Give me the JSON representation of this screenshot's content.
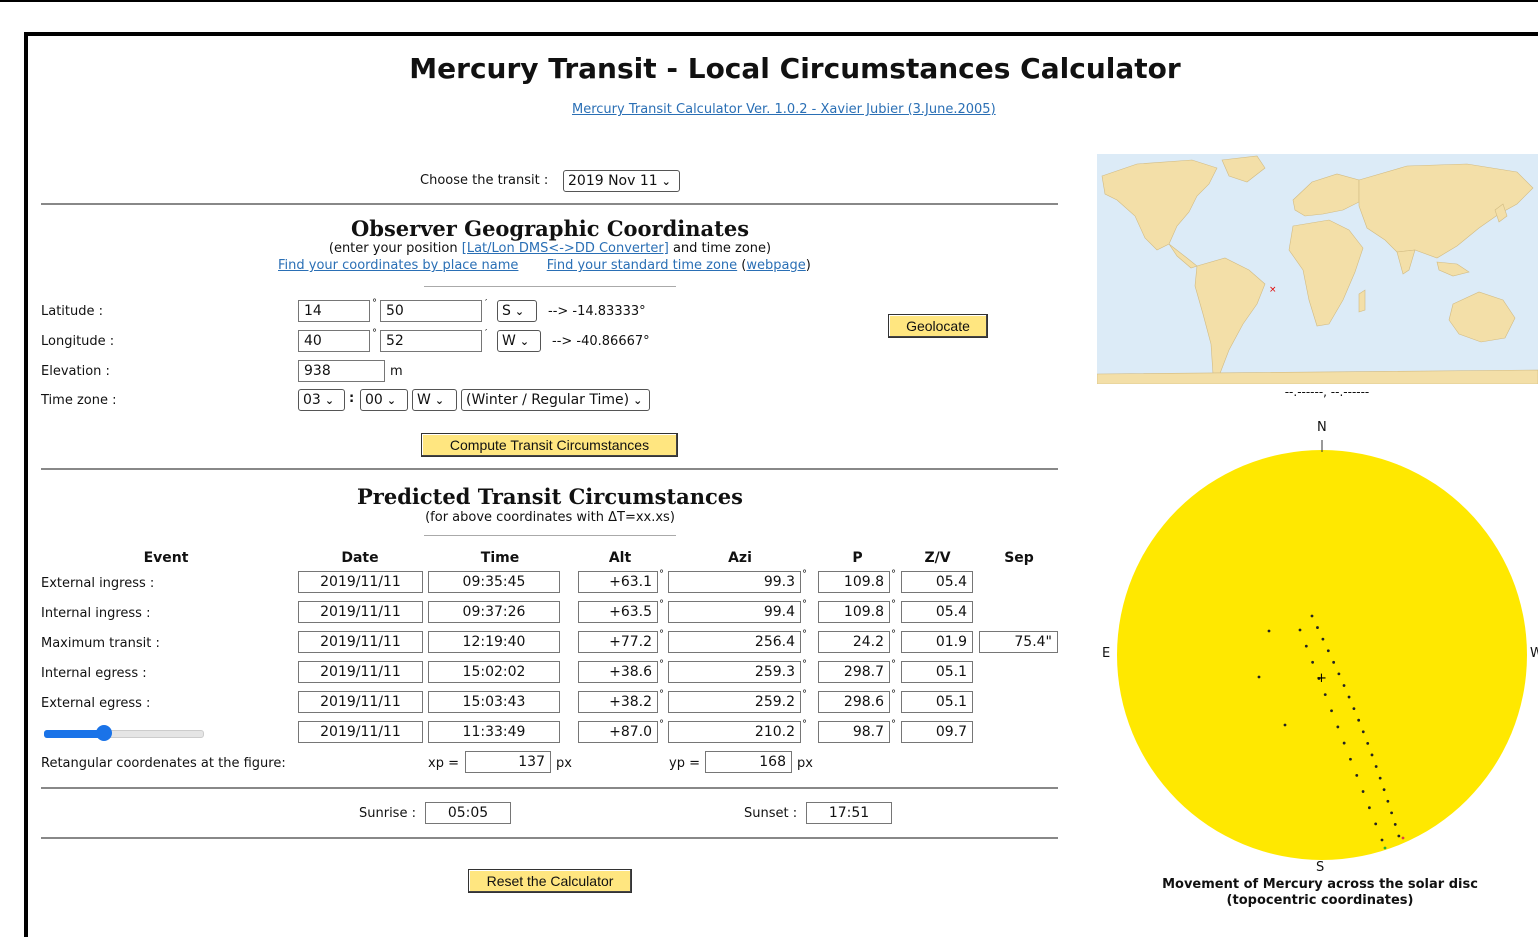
{
  "title": "Mercury Transit - Local Circumstances Calculator",
  "version_link": "Mercury Transit Calculator Ver. 1.0.2 - Xavier Jubier (3.June.2005)",
  "transit": {
    "label": "Choose the transit :",
    "selected": "2019 Nov 11"
  },
  "observer": {
    "heading": "Observer Geographic Coordinates",
    "note_prefix": "(enter your position",
    "converter_link": "[Lat/Lon DMS<->DD Converter]",
    "note_suffix": "and time zone)",
    "place_link": "Find your coordinates by place name",
    "tz_link": "Find your standard time zone",
    "webpage_link": "webpage",
    "latitude": {
      "label": "Latitude :",
      "deg": "14",
      "min": "50",
      "hemi": "S",
      "decimal": "--> -14.83333°"
    },
    "longitude": {
      "label": "Longitude :",
      "deg": "40",
      "min": "52",
      "hemi": "W",
      "decimal": "--> -40.86667°"
    },
    "elevation": {
      "label": "Elevation :",
      "value": "938",
      "unit": "m"
    },
    "timezone": {
      "label": "Time zone :",
      "hours": "03",
      "minutes": "00",
      "dir": "W",
      "kind": "(Winter / Regular Time)"
    },
    "geolocate": "Geolocate",
    "compute": "Compute Transit Circumstances"
  },
  "predicted": {
    "heading": "Predicted Transit Circumstances",
    "note": "(for above coordinates with ΔT=xx.xs)",
    "columns": [
      "Event",
      "Date",
      "Time",
      "Alt",
      "Azi",
      "P",
      "Z/V",
      "Sep"
    ],
    "rows": [
      {
        "event": "External ingress :",
        "date": "2019/11/11",
        "time": "09:35:45",
        "alt": "+63.1",
        "azi": "99.3",
        "p": "109.8",
        "zv": "05.4",
        "sep": ""
      },
      {
        "event": "Internal ingress :",
        "date": "2019/11/11",
        "time": "09:37:26",
        "alt": "+63.5",
        "azi": "99.4",
        "p": "109.8",
        "zv": "05.4",
        "sep": ""
      },
      {
        "event": "Maximum transit :",
        "date": "2019/11/11",
        "time": "12:19:40",
        "alt": "+77.2",
        "azi": "256.4",
        "p": "24.2",
        "zv": "01.9",
        "sep": "75.4\""
      },
      {
        "event": "Internal egress :",
        "date": "2019/11/11",
        "time": "15:02:02",
        "alt": "+38.6",
        "azi": "259.3",
        "p": "298.7",
        "zv": "05.1",
        "sep": ""
      },
      {
        "event": "External egress :",
        "date": "2019/11/11",
        "time": "15:03:43",
        "alt": "+38.2",
        "azi": "259.2",
        "p": "298.6",
        "zv": "05.1",
        "sep": ""
      },
      {
        "event": "",
        "date": "2019/11/11",
        "time": "11:33:49",
        "alt": "+87.0",
        "azi": "210.2",
        "p": "98.7",
        "zv": "09.7",
        "sep": ""
      }
    ],
    "slider_level": 0.38,
    "rect_label": "Retangular coordenates at the figure:",
    "xp_label": "xp =",
    "xp": "137",
    "yp_label": "yp =",
    "yp": "168",
    "px": "px",
    "sunrise_label": "Sunrise :",
    "sunrise": "05:05",
    "sunset_label": "Sunset :",
    "sunset": "17:51",
    "reset": "Reset the Calculator"
  },
  "map": {
    "coords": "--.------, --.------"
  },
  "disc": {
    "n": "N",
    "s": "S",
    "e": "E",
    "w": "W",
    "caption1": "Movement of Mercury across the solar disc",
    "caption2": "(topocentric coordinates)",
    "sun_color": "#ffe800"
  },
  "colors": {
    "button": "#ffe680",
    "link": "#2a6fb5",
    "map_land": "#f3dfa8",
    "map_sea": "#dcebf7"
  }
}
